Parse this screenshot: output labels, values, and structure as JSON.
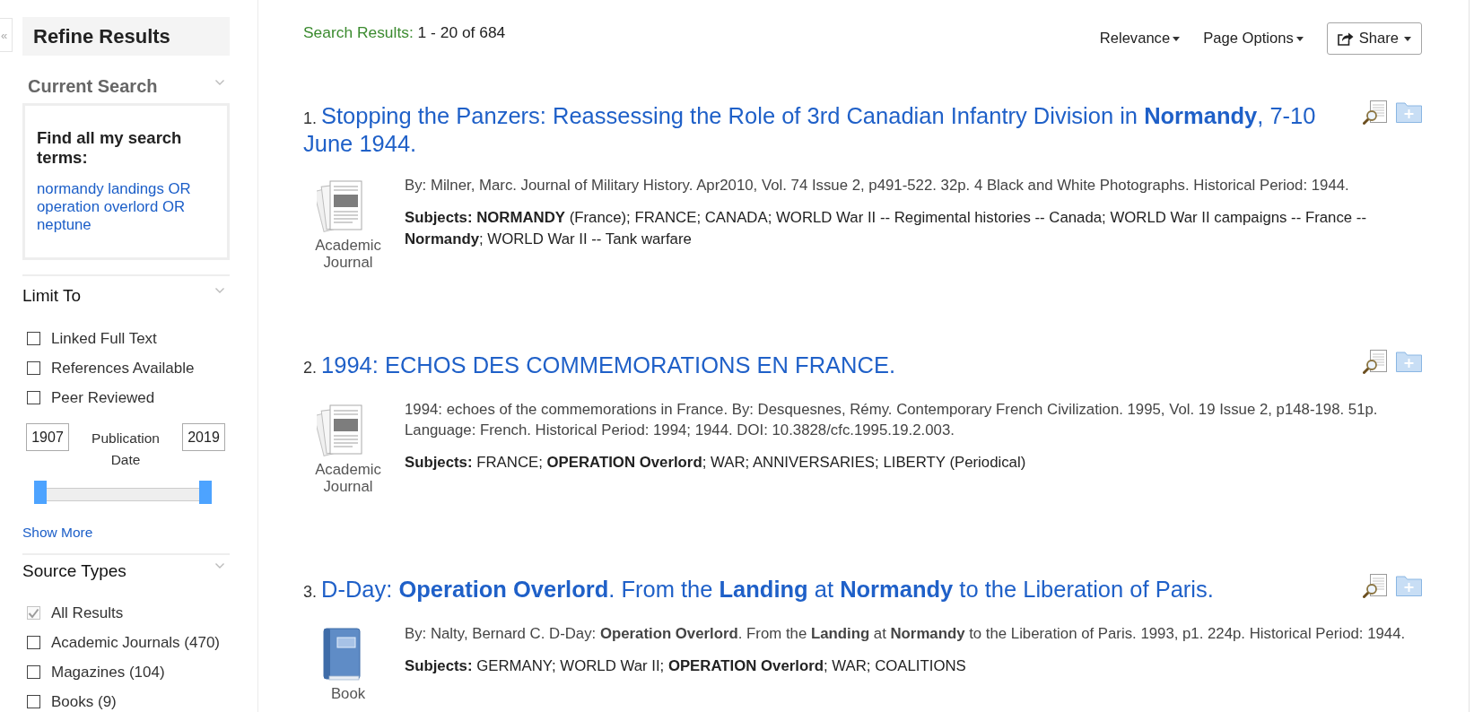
{
  "sidebar_toggle": {
    "label": "«"
  },
  "sidebar": {
    "title": "Refine Results",
    "current_search": {
      "heading": "Current Search",
      "box_title": "Find all my search terms:",
      "query": "normandy landings OR operation overlord OR neptune"
    },
    "limit_to": {
      "heading": "Limit To",
      "options": [
        {
          "label": "Linked Full Text",
          "checked": false,
          "disabled": false
        },
        {
          "label": "References Available",
          "checked": false,
          "disabled": false
        },
        {
          "label": "Peer Reviewed",
          "checked": false,
          "disabled": false
        }
      ],
      "publication_date": {
        "from": "1907",
        "label": "Publication Date",
        "to": "2019",
        "level": 1
      },
      "show_more": "Show More"
    },
    "source_types": {
      "heading": "Source Types",
      "options": [
        {
          "label": "All Results",
          "checked": true,
          "disabled": true
        },
        {
          "label": "Academic Journals (470)",
          "checked": false,
          "disabled": false
        },
        {
          "label": "Magazines (104)",
          "checked": false,
          "disabled": false
        },
        {
          "label": "Books (9)",
          "checked": false,
          "disabled": false
        }
      ]
    }
  },
  "results_summary": {
    "label": "Search Results:",
    "range": "1 - 20 of 684"
  },
  "toolbar": [
    {
      "kind": "dropdown",
      "label": "Relevance"
    },
    {
      "kind": "dropdown",
      "label": "Page Options"
    },
    {
      "kind": "share",
      "label": "Share"
    }
  ],
  "results": [
    {
      "number": "1.",
      "title": "Stopping the Panzers: Reassessing the Role of 3rd Canadian Infantry Division in **Normandy**, 7-10 June 1944.",
      "kind": "journal",
      "type": "Academic Journal",
      "details": "By: Milner, Marc. Journal of Military History. Apr2010, Vol. 74 Issue 2, p491-522. 32p. 4 Black and White Photographs. Historical Period: 1944.",
      "subjects": "**Subjects: NORMANDY** (France); FRANCE; CANADA; WORLD War II -- Regimental histories -- Canada; WORLD War II campaigns -- France -- **Normandy**; WORLD War II -- Tank warfare"
    },
    {
      "number": "2.",
      "title": "1994: ECHOS DES COMMEMORATIONS EN FRANCE.",
      "kind": "journal",
      "type": "Academic Journal",
      "details": "1994: echoes of the commemorations in France. By: Desquesnes, Rémy. Contemporary French Civilization. 1995, Vol. 19 Issue 2, p148-198. 51p. Language: French. Historical Period: 1994; 1944. DOI: 10.3828/cfc.1995.19.2.003.",
      "subjects": "**Subjects:** FRANCE; **OPERATION Overlord**; WAR; ANNIVERSARIES; LIBERTY (Periodical)"
    },
    {
      "number": "3.",
      "title": "D-Day: **Operation Overlord**. From the **Landing** at **Normandy** to the Liberation of Paris.",
      "kind": "book",
      "type": "Book",
      "details": "By: Nalty, Bernard C. D-Day: **Operation Overlord**. From the **Landing** at **Normandy** to the Liberation of Paris. 1993, p1. 224p. Historical Period: 1944.",
      "subjects": "**Subjects:** GERMANY; WORLD War II; **OPERATION Overlord**; WAR; COALITIONS"
    }
  ]
}
